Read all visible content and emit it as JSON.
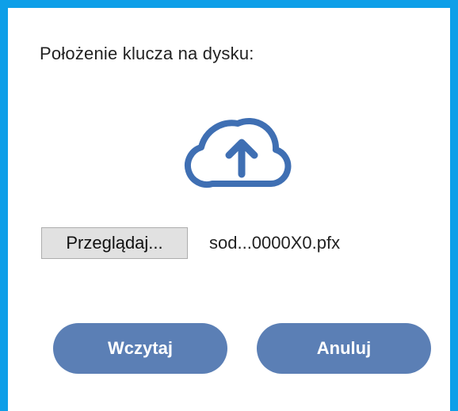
{
  "dialog": {
    "label": "Położenie klucza na dysku:",
    "upload_icon": "cloud-upload-icon",
    "browse_label": "Przeglądaj...",
    "file_name": "sod...0000X0.pfx",
    "load_label": "Wczytaj",
    "cancel_label": "Anuluj"
  },
  "colors": {
    "border": "#0e9fe8",
    "accent": "#5b7fb5",
    "icon": "#3f6fb3",
    "button_gray": "#e1e1e1"
  }
}
